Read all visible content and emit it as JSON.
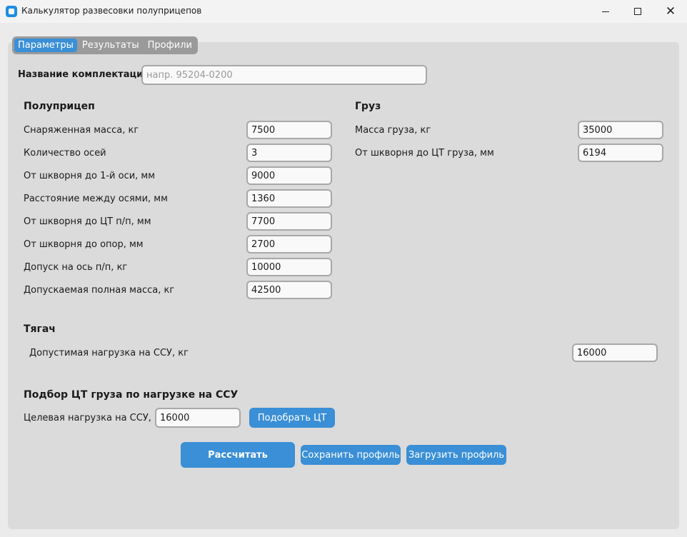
{
  "window": {
    "title": "Калькулятор развесовки полуприцепов",
    "icon": "app-icon"
  },
  "tabs": [
    {
      "label": "Параметры",
      "active": true
    },
    {
      "label": "Результаты",
      "active": false
    },
    {
      "label": "Профили",
      "active": false
    }
  ],
  "config_name": {
    "label": "Название комплектации:",
    "value": "",
    "placeholder": "напр. 95204-0200"
  },
  "semitrailer": {
    "heading": "Полуприцеп",
    "fields": [
      {
        "label": "Снаряженная масса, кг",
        "value": "7500"
      },
      {
        "label": "Количество осей",
        "value": "3"
      },
      {
        "label": "От шкворня до 1-й оси, мм",
        "value": "9000"
      },
      {
        "label": "Расстояние между осями, мм",
        "value": "1360"
      },
      {
        "label": "От шкворня до ЦТ п/п, мм",
        "value": "7700"
      },
      {
        "label": "От шкворня до опор, мм",
        "value": "2700"
      },
      {
        "label": "Допуск на ось п/п, кг",
        "value": "10000"
      },
      {
        "label": "Допускаемая полная масса, кг",
        "value": "42500"
      }
    ]
  },
  "cargo": {
    "heading": "Груз",
    "fields": [
      {
        "label": "Масса груза, кг",
        "value": "35000"
      },
      {
        "label": "От шкворня до ЦТ груза, мм",
        "value": "6194"
      }
    ]
  },
  "tractor": {
    "heading": "Тягач",
    "field": {
      "label": "Допустимая нагрузка на ССУ, кг",
      "value": "16000"
    }
  },
  "cg_selection": {
    "heading": "Подбор ЦТ груза по нагрузке на ССУ",
    "label": "Целевая нагрузка на ССУ, кг:",
    "value": "16000",
    "button": "Подобрать ЦТ"
  },
  "actions": {
    "calculate": "Рассчитать",
    "save_profile": "Сохранить профиль",
    "load_profile": "Загрузить профиль"
  },
  "colors": {
    "accent": "#3a8fd6",
    "panel": "#dbdbdb",
    "tabbar": "#9a9a9a"
  }
}
